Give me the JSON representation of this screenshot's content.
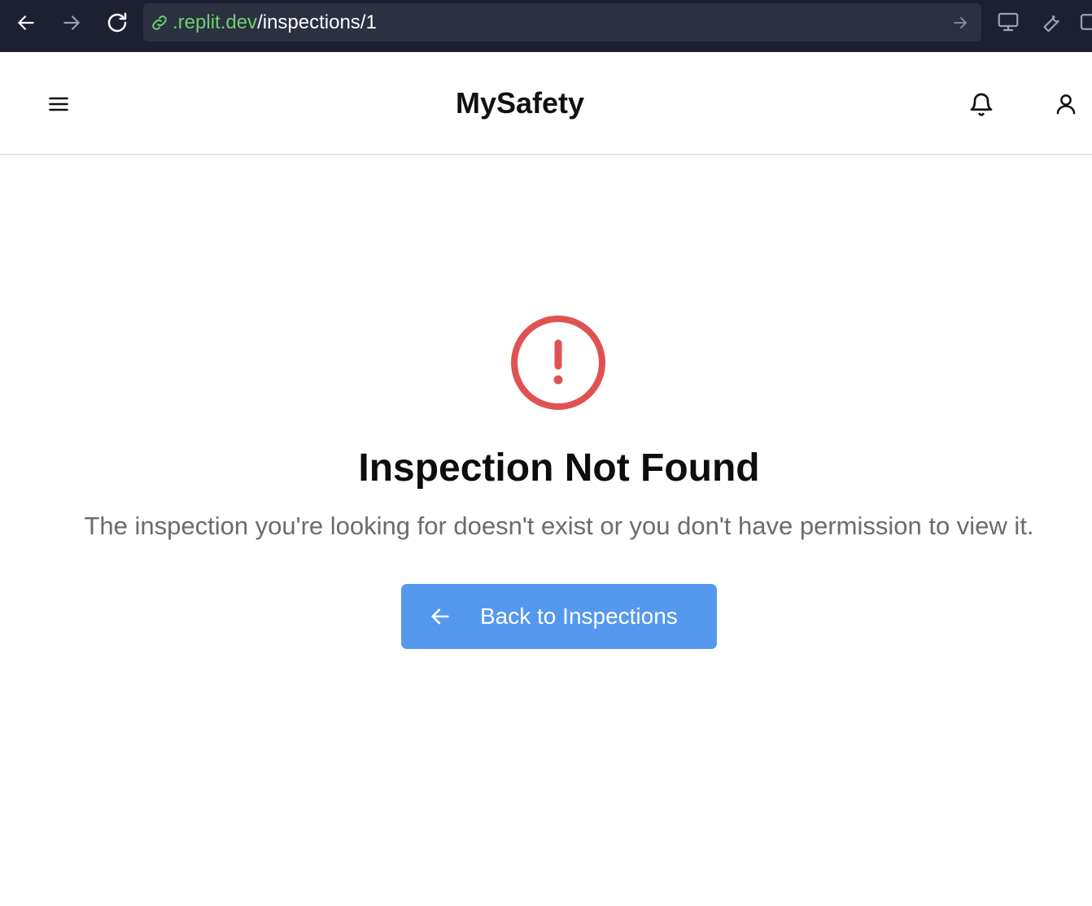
{
  "browser": {
    "url_domain": ".replit.dev",
    "url_path": "/inspections/1",
    "icons": [
      "back-arrow-icon",
      "forward-arrow-icon",
      "reload-icon",
      "link-icon",
      "go-arrow-icon",
      "monitor-icon",
      "wrench-icon",
      "new-window-icon"
    ]
  },
  "header": {
    "title": "MySafety",
    "icons": [
      "menu-icon",
      "bell-icon",
      "user-icon"
    ]
  },
  "main": {
    "icon": "alert-circle-icon",
    "title": "Inspection Not Found",
    "message": "The inspection you're looking for doesn't exist or you don't have permission to view it.",
    "button_label": "Back to Inspections",
    "button_icon": "arrow-left-icon"
  },
  "colors": {
    "chrome_bg": "#1c2030",
    "url_bg": "#2c3142",
    "url_domain": "#6fcf6f",
    "alert": "#e05252",
    "button_bg": "#5599ee",
    "message_text": "#6b6b6b"
  }
}
